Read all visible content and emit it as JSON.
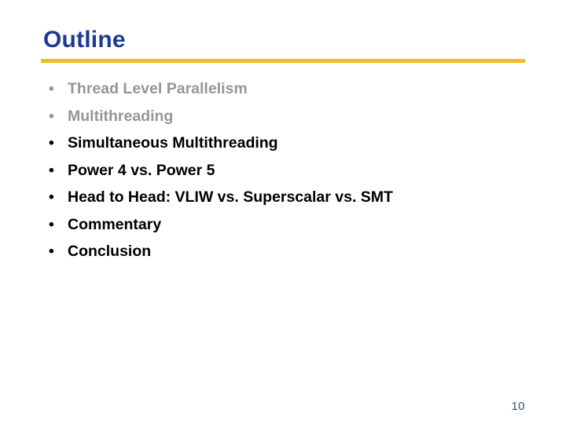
{
  "slide": {
    "title": "Outline",
    "page_number": "10",
    "colors": {
      "title": "#1b3a91",
      "rule": "#efbe24",
      "body_active": "#000000",
      "body_dimmed": "#969696",
      "page_number": "#2e5276",
      "background": "#ffffff"
    },
    "bullet_marker": "•",
    "items": [
      {
        "label": "Thread Level Parallelism",
        "state": "dimmed"
      },
      {
        "label": "Multithreading",
        "state": "dimmed"
      },
      {
        "label": "Simultaneous Multithreading",
        "state": "active"
      },
      {
        "label": "Power 4 vs. Power 5",
        "state": "active"
      },
      {
        "label": "Head to Head: VLIW vs. Superscalar vs. SMT",
        "state": "active"
      },
      {
        "label": "Commentary",
        "state": "active"
      },
      {
        "label": "Conclusion",
        "state": "active"
      }
    ]
  }
}
